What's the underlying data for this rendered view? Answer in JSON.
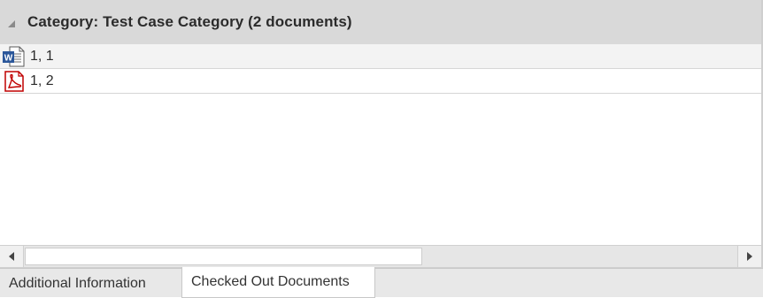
{
  "group": {
    "title": "Category: Test Case Category (2 documents)",
    "toggle_icon": "expanded-triangle-icon"
  },
  "documents": [
    {
      "label": "1, 1",
      "icon": "word-document-icon",
      "selected": true
    },
    {
      "label": "1, 2",
      "icon": "pdf-document-icon",
      "selected": false
    }
  ],
  "tabs": [
    {
      "label": "Additional Information",
      "active": false
    },
    {
      "label": "Checked Out Documents",
      "active": true
    }
  ],
  "colors": {
    "word_blue": "#2b579a",
    "pdf_red": "#c00000",
    "header_bg": "#d9d9d9"
  }
}
